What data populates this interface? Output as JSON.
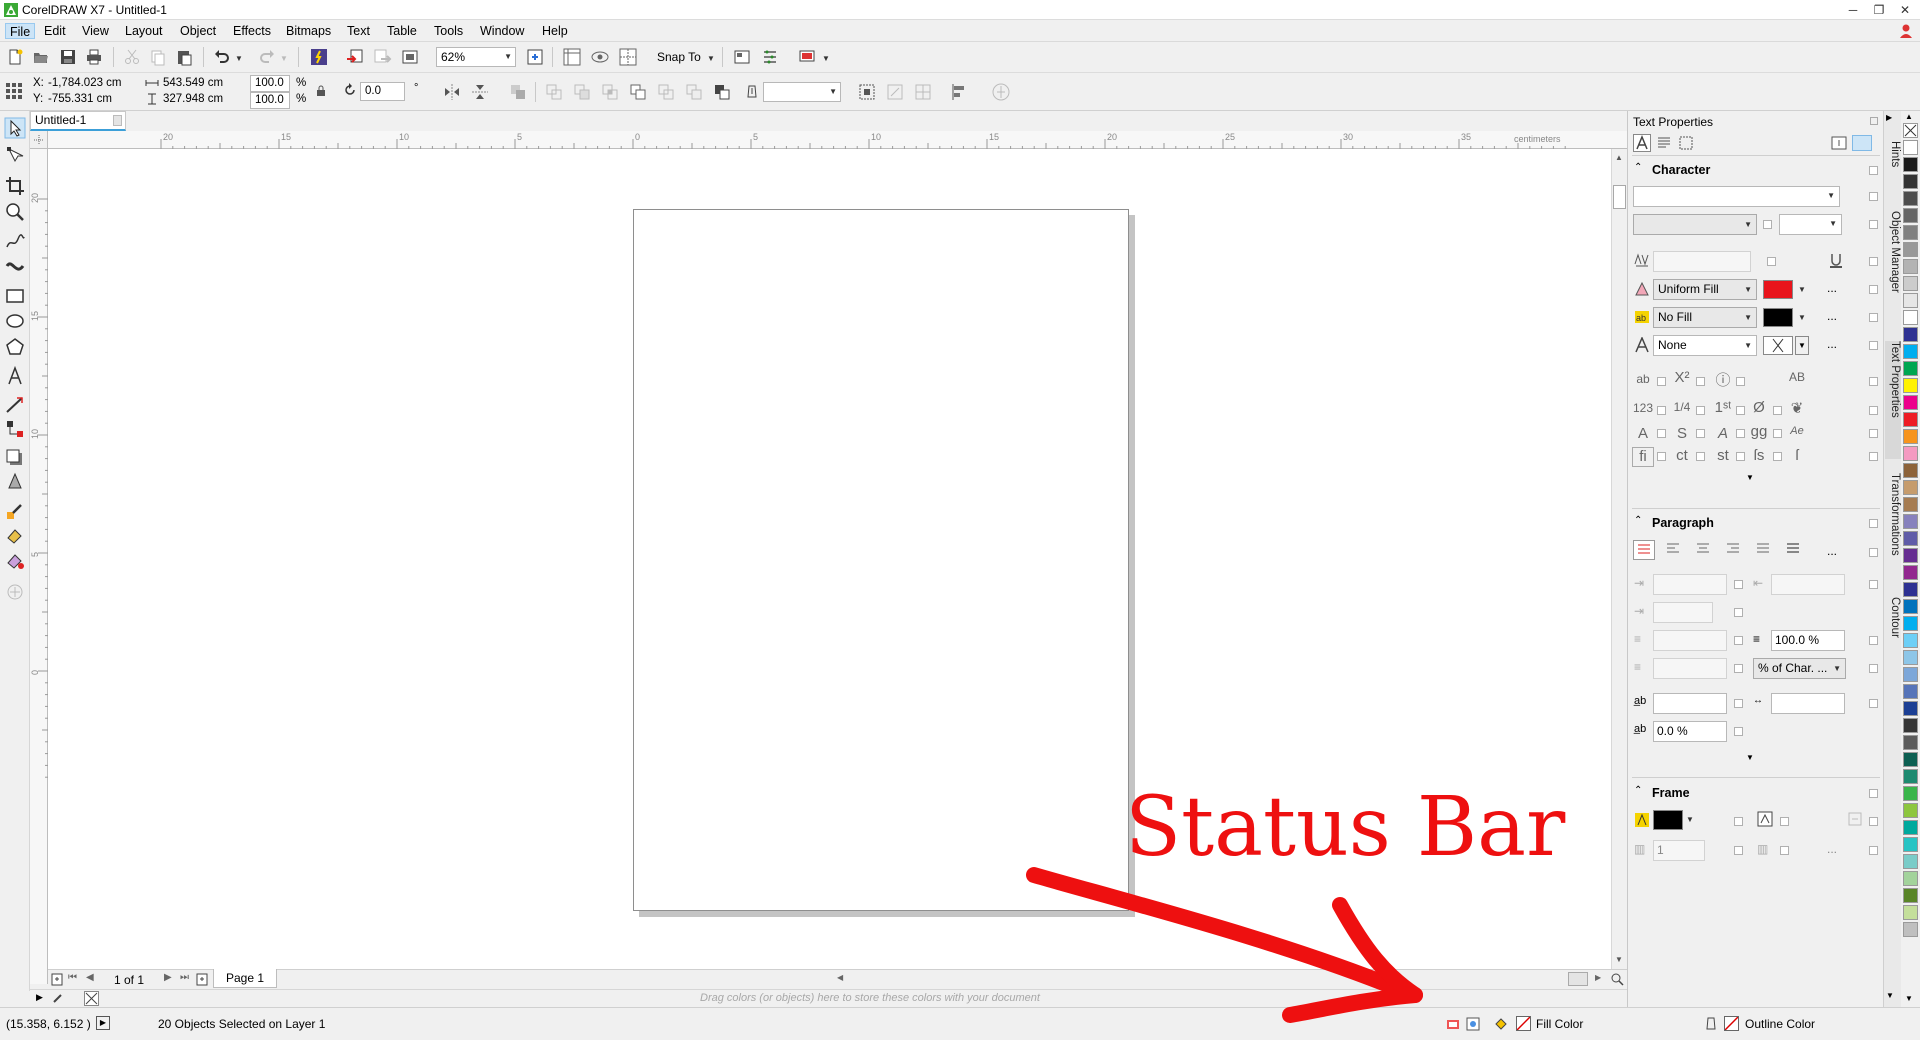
{
  "window": {
    "title": "CorelDRAW X7 - Untitled-1",
    "min_glyph": "─",
    "max_glyph": "❐",
    "close_glyph": "✕"
  },
  "menu": [
    {
      "label": "File",
      "active": true
    },
    {
      "label": "Edit"
    },
    {
      "label": "View"
    },
    {
      "label": "Layout"
    },
    {
      "label": "Object"
    },
    {
      "label": "Effects"
    },
    {
      "label": "Bitmaps"
    },
    {
      "label": "Text"
    },
    {
      "label": "Table"
    },
    {
      "label": "Tools"
    },
    {
      "label": "Window"
    },
    {
      "label": "Help"
    }
  ],
  "toolbar": {
    "zoom_value": "62%",
    "snap_to_label": "Snap To"
  },
  "property_bar": {
    "x_label": "X:",
    "x_value": "-1,784.023 cm",
    "y_label": "Y:",
    "y_value": "-755.331 cm",
    "width_value": "543.549 cm",
    "height_value": "327.948 cm",
    "scale_w": "100.0",
    "scale_h": "100.0",
    "percent_w": "%",
    "percent_h": "%",
    "rotation_value": "0.0",
    "degree_symbol": "°"
  },
  "document": {
    "tab_label": "Untitled-1",
    "ruler_unit": "centimeters",
    "ruler_ticks": [
      "20",
      "15",
      "10",
      "5",
      "0",
      "5",
      "10",
      "15",
      "20",
      "25",
      "30",
      "35"
    ],
    "vruler_ticks": [
      "20",
      "15",
      "10",
      "5",
      "0"
    ],
    "page_count_text": "1 of 1",
    "page_tab_label": "Page 1"
  },
  "color_tray": {
    "hint": "Drag colors (or objects) here to store these colors with your document"
  },
  "status_bar": {
    "coordinates": "(15.358, 6.152 )",
    "selection_info": "20 Objects Selected on Layer 1",
    "fill_label": "Fill Color",
    "outline_label": "Outline Color"
  },
  "docker": {
    "title": "Text Properties",
    "character": {
      "heading": "Character",
      "fill_type": "Uniform Fill",
      "fill_color": "#e8141c",
      "background_fill_type": "No Fill",
      "background_fill_color": "#000000",
      "outline_type": "None",
      "more_label": "..."
    },
    "paragraph": {
      "heading": "Paragraph",
      "line_spacing_value": "100.0 %",
      "spacing_unit": "% of Char. ...",
      "char_spacing_value": "0.0 %",
      "more_label": "..."
    },
    "frame": {
      "heading": "Frame",
      "columns_value": "1",
      "more_label": "..."
    }
  },
  "side_tabs": [
    "Hints",
    "Object Manager",
    "Text Properties",
    "Transformations",
    "Contour"
  ],
  "palette": [
    "#ffffff",
    "#1a1a1a",
    "#333333",
    "#4d4d4d",
    "#666666",
    "#808080",
    "#999999",
    "#b3b3b3",
    "#cccccc",
    "#e6e6e6",
    "#ffffff",
    "#2e3192",
    "#00aeef",
    "#00a651",
    "#fff200",
    "#ec008c",
    "#ed1c24",
    "#f7941d",
    "#f49ac1",
    "#8c6239",
    "#c69c6d",
    "#a67c52",
    "#8781bd",
    "#605ca8",
    "#662d91",
    "#92278f",
    "#2e3192",
    "#0072bc",
    "#00aeef",
    "#6dcff6",
    "#8dc6e8",
    "#7da7d9",
    "#5674b9",
    "#1c3f94",
    "#363636",
    "#5c5c5c",
    "#0d5f52",
    "#1d8a70",
    "#39b54a",
    "#8dc63f",
    "#00a99d",
    "#27c4c4",
    "#7accc8",
    "#a3d39c",
    "#598527",
    "#c4df9b",
    "#bfbfbf"
  ],
  "annotation": {
    "text": "Status Bar",
    "color": "#ee1010"
  }
}
